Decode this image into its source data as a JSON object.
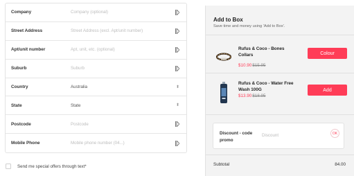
{
  "form": {
    "fields": [
      {
        "label": "Company",
        "placeholder": "Company (optional)",
        "value": "",
        "icon": "autofill-icon"
      },
      {
        "label": "Street Address",
        "placeholder": "Street Address (excl. Apt/unit number)",
        "value": "",
        "icon": "autofill-icon"
      },
      {
        "label": "Apt/unit number",
        "placeholder": "Apt, unit, etc. (optional)",
        "value": "",
        "icon": "autofill-icon"
      },
      {
        "label": "Suburb",
        "placeholder": "Suburb",
        "value": "",
        "icon": "autofill-icon"
      },
      {
        "label": "Country",
        "placeholder": "",
        "value": "Australia",
        "icon": "select-arrows-icon"
      },
      {
        "label": "State",
        "placeholder": "",
        "value": "State",
        "icon": "select-arrows-icon"
      },
      {
        "label": "Postcode",
        "placeholder": "Postcode",
        "value": "",
        "icon": "autofill-icon"
      },
      {
        "label": "Mobile Phone",
        "placeholder": "Mobile phone number (04...)",
        "value": "",
        "icon": "autofill-icon"
      }
    ],
    "offer_label": "Send me special offers through text*"
  },
  "add_to_box": {
    "title": "Add to Box",
    "subtitle": "Save time and money using 'Add to Box'.",
    "products": [
      {
        "name": "Rufus & Coco - Bones Collars",
        "price": "$10.90",
        "was": "$15.95",
        "button": "Colour",
        "icon": "collar-icon"
      },
      {
        "name": "Rufus & Coco - Water Free Wash 100G",
        "price": "$13.90",
        "was": "$18.95",
        "button": "Add",
        "icon": "wash-bottle-icon"
      }
    ]
  },
  "discount": {
    "label": "Discount - code promo",
    "placeholder": "Discount",
    "button": "OK"
  },
  "summary": {
    "subtotal_label": "Subtotal",
    "subtotal_value": "84.00"
  },
  "colors": {
    "accent": "#ff3c57",
    "panel_bg": "#f3f3f3"
  }
}
